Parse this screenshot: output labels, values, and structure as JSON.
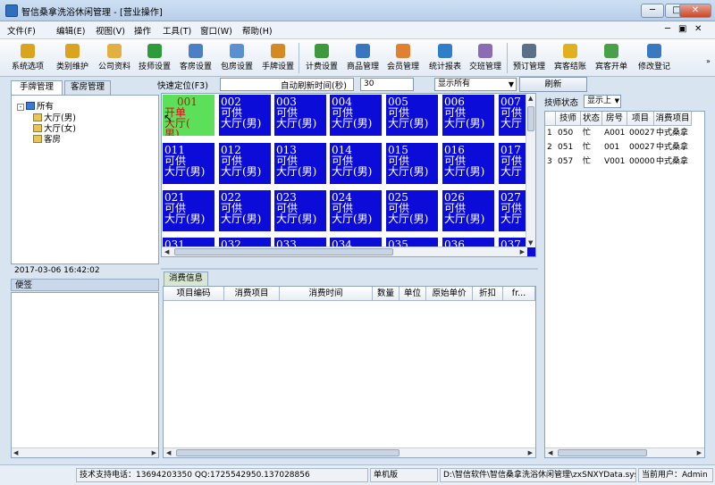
{
  "window": {
    "title": "智信桑拿洗浴休闲管理 - [营业操作]"
  },
  "menu": [
    {
      "label": "文件(F)"
    },
    {
      "label": "编辑(E)"
    },
    {
      "label": "视图(V)"
    },
    {
      "label": "操作"
    },
    {
      "label": "工具(T)"
    },
    {
      "label": "窗口(W)"
    },
    {
      "label": "帮助(H)"
    }
  ],
  "toolbar": [
    {
      "label": "系统选项",
      "icon": "key-icon",
      "color": "#d9a520"
    },
    {
      "label": "类别维护",
      "icon": "tools-icon",
      "color": "#d9a520"
    },
    {
      "label": "公司资料",
      "icon": "folder-icon",
      "color": "#e0b040"
    },
    {
      "label": "技师设置",
      "icon": "technician-icon",
      "color": "#2e9b3a"
    },
    {
      "label": "客房设置",
      "icon": "guest-room-icon",
      "color": "#4d7fc4"
    },
    {
      "label": "包房设置",
      "icon": "private-room-icon",
      "color": "#5a8fd0"
    },
    {
      "label": "手牌设置",
      "icon": "hand-tag-icon",
      "color": "#d48a22"
    },
    {
      "label": "计费设置",
      "icon": "billing-icon",
      "color": "#3c9a3c"
    },
    {
      "label": "商品管理",
      "icon": "goods-icon",
      "color": "#3a76c0"
    },
    {
      "label": "会员管理",
      "icon": "member-icon",
      "color": "#e08030"
    },
    {
      "label": "统计报表",
      "icon": "report-chart-icon",
      "color": "#2e7fc8"
    },
    {
      "label": "交班管理",
      "icon": "shift-users-icon",
      "color": "#8a6bb5"
    },
    {
      "label": "预订管理",
      "icon": "phone-icon",
      "color": "#5a6f8a"
    },
    {
      "label": "宾客结账",
      "icon": "coin-icon",
      "color": "#e0b020"
    },
    {
      "label": "宾客开单",
      "icon": "open-bill-icon",
      "color": "#4aa04a"
    },
    {
      "label": "修改登记",
      "icon": "edit-user-icon",
      "color": "#3a78c0"
    }
  ],
  "tabs": [
    {
      "label": "手牌管理"
    },
    {
      "label": "客房管理"
    }
  ],
  "quick": {
    "locate_label": "快速定位(F3)",
    "locate_value": "",
    "refresh_label": "自动刷新时间(秒)",
    "refresh_value": "30",
    "filter_value": "显示所有",
    "refresh_button": "刷新"
  },
  "tree": {
    "root": "所有",
    "children": [
      "大厅(男)",
      "大厅(女)",
      "客房"
    ]
  },
  "datetime": "2017-03-06  16:42:02",
  "memo_label": "便签",
  "tiles": [
    [
      {
        "no": "001",
        "status": "开单",
        "area": "大厅(",
        "extra": "男)"
      },
      {
        "no": "002",
        "status": "可供",
        "area": "大厅(男)"
      },
      {
        "no": "003",
        "status": "可供",
        "area": "大厅(男)"
      },
      {
        "no": "004",
        "status": "可供",
        "area": "大厅(男)"
      },
      {
        "no": "005",
        "status": "可供",
        "area": "大厅(男)"
      },
      {
        "no": "006",
        "status": "可供",
        "area": "大厅(男)"
      },
      {
        "no": "007",
        "status": "可供",
        "area": "大厅"
      }
    ],
    [
      {
        "no": "011",
        "status": "可供",
        "area": "大厅(男)"
      },
      {
        "no": "012",
        "status": "可供",
        "area": "大厅(男)"
      },
      {
        "no": "013",
        "status": "可供",
        "area": "大厅(男)"
      },
      {
        "no": "014",
        "status": "可供",
        "area": "大厅(男)"
      },
      {
        "no": "015",
        "status": "可供",
        "area": "大厅(男)"
      },
      {
        "no": "016",
        "status": "可供",
        "area": "大厅(男)"
      },
      {
        "no": "017",
        "status": "可供",
        "area": "大厅"
      }
    ],
    [
      {
        "no": "021",
        "status": "可供",
        "area": "大厅(男)"
      },
      {
        "no": "022",
        "status": "可供",
        "area": "大厅(男)"
      },
      {
        "no": "023",
        "status": "可供",
        "area": "大厅(男)"
      },
      {
        "no": "024",
        "status": "可供",
        "area": "大厅(男)"
      },
      {
        "no": "025",
        "status": "可供",
        "area": "大厅(男)"
      },
      {
        "no": "026",
        "status": "可供",
        "area": "大厅(男)"
      },
      {
        "no": "027",
        "status": "可供",
        "area": "大厅"
      }
    ],
    [
      {
        "no": "031"
      },
      {
        "no": "032"
      },
      {
        "no": "033"
      },
      {
        "no": "034"
      },
      {
        "no": "035"
      },
      {
        "no": "036"
      },
      {
        "no": "037"
      }
    ]
  ],
  "consume": {
    "tab_label": "消费信息",
    "columns": [
      "项目编码",
      "消费项目",
      "消费时间",
      "数量",
      "单位",
      "原始单价",
      "折扣",
      "fr..."
    ]
  },
  "tech": {
    "label": "技师状态",
    "filter_value": "显示上",
    "columns": [
      "技师",
      "状态",
      "房号",
      "项目",
      "消费项目"
    ],
    "rows": [
      {
        "idx": "1",
        "tech": "050",
        "status": "忙",
        "room": "A001",
        "item": "00027",
        "consume": "中式桑拿"
      },
      {
        "idx": "2",
        "tech": "051",
        "status": "忙",
        "room": "001",
        "item": "00027",
        "consume": "中式桑拿"
      },
      {
        "idx": "3",
        "tech": "057",
        "status": "忙",
        "room": "V001",
        "item": "00000",
        "consume": "中式桑拿"
      }
    ]
  },
  "status_bar": {
    "support": "技术支持电话：13694203350 QQ:1725542950.137028856",
    "edition": "单机版",
    "path": "D:\\智信软件\\智信桑拿洗浴休闲管理\\zxSNXYData.sys",
    "user": "当前用户：Admin"
  }
}
